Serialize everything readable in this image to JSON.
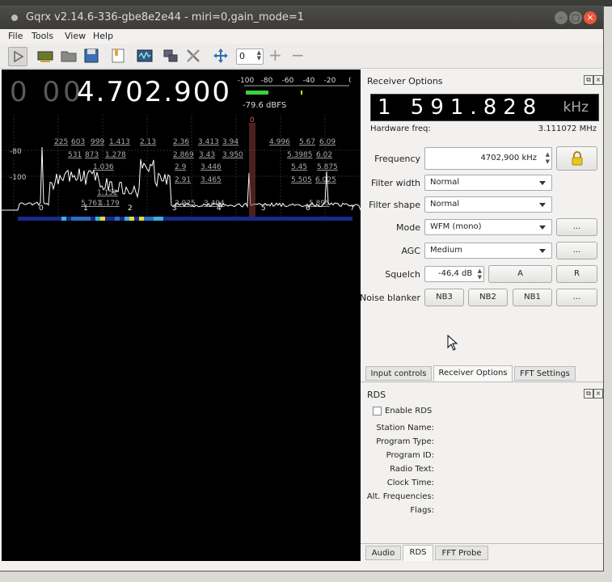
{
  "window": {
    "title": "Gqrx v2.14.6-336-gbe8e2e44 - miri=0,gain_mode=1"
  },
  "menu": [
    "File",
    "Tools",
    "View",
    "Help"
  ],
  "toolbar": {
    "spin_value": "0",
    "plus": "+",
    "minus": "−"
  },
  "spectrum": {
    "freq_dim": "0 00",
    "freq_main": "4.702.900",
    "meter_ticks": [
      "-100",
      "-80",
      "-60",
      "-40",
      "-20",
      "0"
    ],
    "meter_readout": "-79.6 dBFS",
    "db_labels": [
      "-80",
      "-100"
    ],
    "freq_ticks": [
      "0",
      "1",
      "2",
      "3",
      "4",
      "5",
      "6",
      "7"
    ],
    "center_mark": "0",
    "overlay_labels": [
      "225",
      "603",
      "999",
      "1.413",
      "2.13",
      "2.36",
      "3.413",
      "3.94",
      "4.996",
      "5.67",
      "6.09",
      "531",
      "873",
      "1.278",
      "2.869",
      "3.43",
      "3.950",
      "5.3985",
      "6.02",
      "1.036",
      "2.9",
      "3.446",
      "5.45",
      "5.875",
      "2.91",
      "3.465",
      "5.505",
      "6.025",
      "1.152",
      "5.761",
      "1.179",
      "2.925",
      "3.494",
      "5.895"
    ]
  },
  "receiver": {
    "title": "Receiver Options",
    "lcd_value": "1 591.828",
    "lcd_unit": "kHz",
    "hw_label": "Hardware freq:",
    "hw_value": "3.111072 MHz",
    "frequency_label": "Frequency",
    "frequency_value": "4702,900 kHz",
    "filter_width_label": "Filter width",
    "filter_width_value": "Normal",
    "filter_shape_label": "Filter shape",
    "filter_shape_value": "Normal",
    "mode_label": "Mode",
    "mode_value": "WFM (mono)",
    "agc_label": "AGC",
    "agc_value": "Medium",
    "squelch_label": "Squelch",
    "squelch_value": "-46,4 dB",
    "squelch_a": "A",
    "squelch_r": "R",
    "nb_label": "Noise blanker",
    "nb3": "NB3",
    "nb2": "NB2",
    "nb1": "NB1",
    "more": "..."
  },
  "tabs_top": [
    "Input controls",
    "Receiver Options",
    "FFT Settings"
  ],
  "rds": {
    "title": "RDS",
    "enable_label": "Enable RDS",
    "fields": [
      "Station Name:",
      "Program Type:",
      "Program ID:",
      "Radio Text:",
      "Clock Time:",
      "Alt. Frequencies:",
      "Flags:"
    ]
  },
  "tabs_bottom": [
    "Audio",
    "RDS",
    "FFT Probe"
  ]
}
